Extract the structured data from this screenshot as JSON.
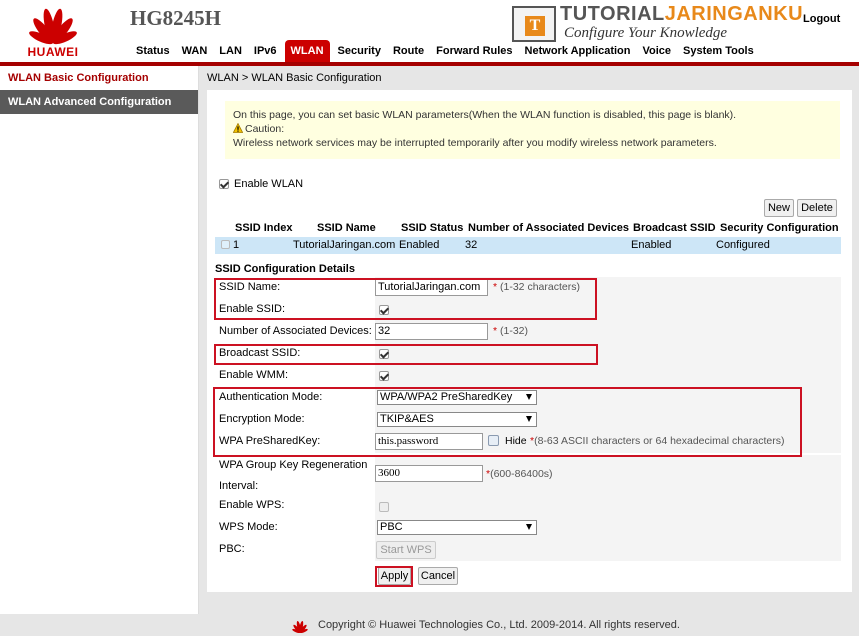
{
  "header": {
    "brand_name": "HUAWEI",
    "model": "HG8245H",
    "watermark_main_a": "TUTORIAL",
    "watermark_main_b": "JARINGANKU",
    "watermark_sub": "Configure Your Knowledge",
    "watermark_letter": "T",
    "logout": "Logout",
    "nav": [
      "Status",
      "WAN",
      "LAN",
      "IPv6",
      "WLAN",
      "Security",
      "Route",
      "Forward Rules",
      "Network Application",
      "Voice",
      "System Tools"
    ],
    "active_nav": "WLAN"
  },
  "sidebar": {
    "items": [
      {
        "label": "WLAN Basic Configuration",
        "active": true
      },
      {
        "label": "WLAN Advanced Configuration",
        "active": false
      }
    ]
  },
  "breadcrumb": "WLAN > WLAN Basic Configuration",
  "notice": {
    "line1": "On this page, you can set basic WLAN parameters(When the WLAN function is disabled, this page is blank).",
    "caution": "Caution:",
    "line2": "Wireless network services may be interrupted temporarily after you modify wireless network parameters."
  },
  "enable_wlan": {
    "label": "Enable WLAN",
    "checked": true
  },
  "table_buttons": {
    "new": "New",
    "delete": "Delete"
  },
  "ssid_table": {
    "headers": [
      "SSID Index",
      "SSID Name",
      "SSID Status",
      "Number of Associated Devices",
      "Broadcast SSID",
      "Security Configuration"
    ],
    "rows": [
      [
        "1",
        "TutorialJaringan.com",
        "Enabled",
        "32",
        "Enabled",
        "Configured"
      ]
    ]
  },
  "details_title": "SSID Configuration Details",
  "form": {
    "ssid_name": {
      "label": "SSID Name:",
      "value": "TutorialJaringan.com",
      "star": "*",
      "hint": " (1-32 characters)"
    },
    "enable_ssid": {
      "label": "Enable SSID:",
      "checked": true
    },
    "assoc_devices": {
      "label": "Number of Associated Devices:",
      "value": "32",
      "star": "*",
      "hint": " (1-32)"
    },
    "broadcast_ssid": {
      "label": "Broadcast SSID:",
      "checked": true
    },
    "enable_wmm": {
      "label": "Enable WMM:",
      "checked": true
    },
    "auth_mode": {
      "label": "Authentication Mode:",
      "value": "WPA/WPA2 PreSharedKey"
    },
    "enc_mode": {
      "label": "Encryption Mode:",
      "value": "TKIP&AES"
    },
    "psk": {
      "label": "WPA PreSharedKey:",
      "value": "this.password",
      "hide_label": "Hide",
      "star": "*",
      "hint": "(8-63 ASCII characters or 64 hexadecimal characters)"
    },
    "group_key": {
      "label_line1": "WPA Group Key Regeneration",
      "label_line2": "Interval:",
      "value": "3600",
      "star": "*",
      "hint": "(600-86400s)"
    },
    "enable_wps": {
      "label": "Enable WPS:",
      "checked": false
    },
    "wps_mode": {
      "label": "WPS Mode:",
      "value": "PBC"
    },
    "pbc": {
      "label": "PBC:",
      "button": "Start WPS"
    }
  },
  "actions": {
    "apply": "Apply",
    "cancel": "Cancel"
  },
  "footer": {
    "copyright": "Copyright © Huawei Technologies Co., Ltd. 2009-2014. All rights reserved."
  },
  "colors": {
    "accent": "#cc0000",
    "nav_bar": "#a50000",
    "highlight": "#cc1122",
    "row_select": "#cde6f7",
    "notice_bg": "#ffffe0"
  }
}
